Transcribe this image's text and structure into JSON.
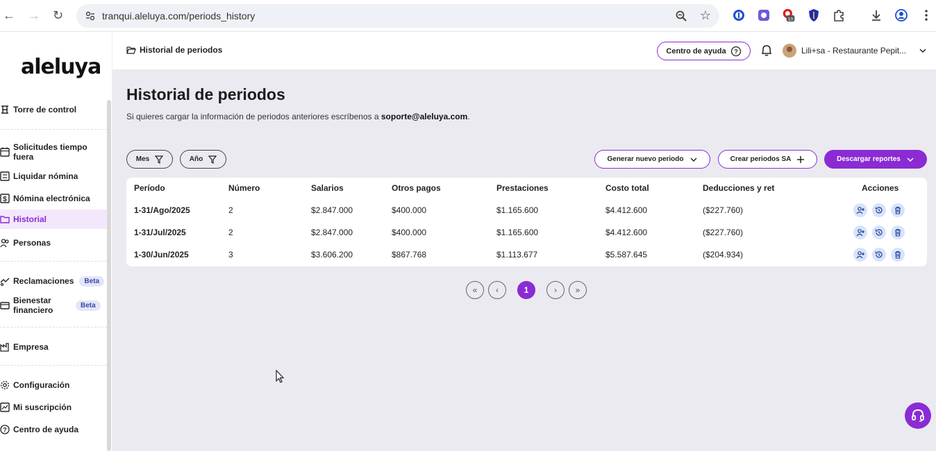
{
  "browser": {
    "url": "tranqui.aleluya.com/periods_history",
    "extension_badge": "10"
  },
  "sidebar": {
    "logo": "aleluya",
    "items": [
      {
        "label": "Torre de control",
        "icon": "tower-icon",
        "active": false
      },
      {
        "label": "Solicitudes tiempo fuera",
        "icon": "calendar-icon",
        "active": false
      },
      {
        "label": "Liquidar nómina",
        "icon": "payroll-icon",
        "active": false
      },
      {
        "label": "Nómina electrónica",
        "icon": "dollar-doc-icon",
        "active": false
      },
      {
        "label": "Historial",
        "icon": "folder-icon",
        "active": true
      },
      {
        "label": "Personas",
        "icon": "people-icon",
        "active": false
      },
      {
        "label": "Reclamaciones",
        "icon": "claims-icon",
        "badge": "Beta",
        "active": false
      },
      {
        "label": "Bienestar financiero",
        "icon": "wallet-icon",
        "badge": "Beta",
        "active": false
      },
      {
        "label": "Empresa",
        "icon": "factory-icon",
        "active": false
      },
      {
        "label": "Configuración",
        "icon": "gear-icon",
        "active": false
      },
      {
        "label": "Mi suscripción",
        "icon": "subscription-icon",
        "active": false
      },
      {
        "label": "Centro de ayuda",
        "icon": "help-icon",
        "active": false
      }
    ]
  },
  "topbar": {
    "breadcrumb": "Historial de periodos",
    "help_button": "Centro de ayuda",
    "user_name": "Lili+sa - Restaurante Pepit..."
  },
  "main": {
    "title": "Historial de periodos",
    "subtitle_prefix": "Si quieres cargar la información de periodos anteriores escríbenos a ",
    "subtitle_email": "soporte@aleluya.com",
    "subtitle_suffix": ".",
    "filters": {
      "month": "Mes",
      "year": "Año"
    },
    "actions": {
      "generate": "Generar nuevo periodo",
      "create_sa": "Crear periodos SA",
      "download": "Descargar reportes"
    },
    "table": {
      "headers": [
        "Período",
        "Número",
        "Salarios",
        "Otros pagos",
        "Prestaciones",
        "Costo total",
        "Deducciones y ret",
        "Acciones"
      ],
      "rows": [
        [
          "1-31/Ago/2025",
          "2",
          "$2.847.000",
          "$400.000",
          "$1.165.600",
          "$4.412.600",
          "($227.760)"
        ],
        [
          "1-31/Jul/2025",
          "2",
          "$2.847.000",
          "$400.000",
          "$1.165.600",
          "$4.412.600",
          "($227.760)"
        ],
        [
          "1-30/Jun/2025",
          "3",
          "$3.606.200",
          "$867.768",
          "$1.113.677",
          "$5.587.645",
          "($204.934)"
        ]
      ]
    },
    "pagination": {
      "first": "«",
      "prev": "‹",
      "current": "1",
      "next": "›",
      "last": "»"
    }
  },
  "colors": {
    "accent": "#8a2bd4",
    "background": "#ebeaf0",
    "action_bg": "#d7e3fb"
  }
}
